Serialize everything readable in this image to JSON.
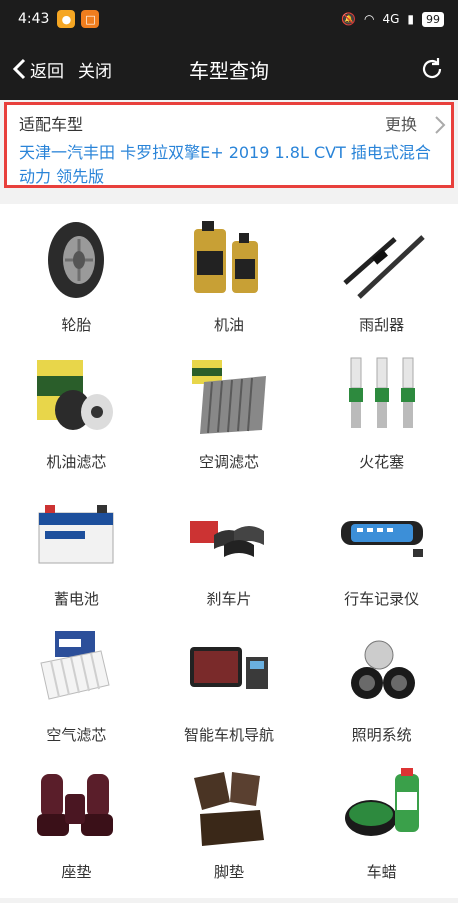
{
  "status": {
    "time": "4:43",
    "net": "4G",
    "battery": "99"
  },
  "nav": {
    "back_label": "返回",
    "close_label": "关闭",
    "title": "车型查询"
  },
  "model": {
    "heading": "适配车型",
    "change_label": "更换",
    "name": "天津一汽丰田 卡罗拉双擎E+ 2019 1.8L CVT 插电式混合动力 领先版"
  },
  "categories": [
    {
      "label": "轮胎",
      "icon": "tire-icon"
    },
    {
      "label": "机油",
      "icon": "engine-oil-icon"
    },
    {
      "label": "雨刮器",
      "icon": "wiper-icon"
    },
    {
      "label": "机油滤芯",
      "icon": "oil-filter-icon"
    },
    {
      "label": "空调滤芯",
      "icon": "ac-filter-icon"
    },
    {
      "label": "火花塞",
      "icon": "spark-plug-icon"
    },
    {
      "label": "蓄电池",
      "icon": "battery-icon"
    },
    {
      "label": "刹车片",
      "icon": "brake-pad-icon"
    },
    {
      "label": "行车记录仪",
      "icon": "dashcam-icon"
    },
    {
      "label": "空气滤芯",
      "icon": "air-filter-icon"
    },
    {
      "label": "智能车机导航",
      "icon": "navigation-unit-icon"
    },
    {
      "label": "照明系统",
      "icon": "headlight-icon"
    },
    {
      "label": "座垫",
      "icon": "seat-cushion-icon"
    },
    {
      "label": "脚垫",
      "icon": "floor-mat-icon"
    },
    {
      "label": "车蜡",
      "icon": "car-wax-icon"
    }
  ],
  "colors": {
    "highlight_border": "#e8403c",
    "model_text": "#2a84d8",
    "header_bg": "#1c1c1c"
  }
}
